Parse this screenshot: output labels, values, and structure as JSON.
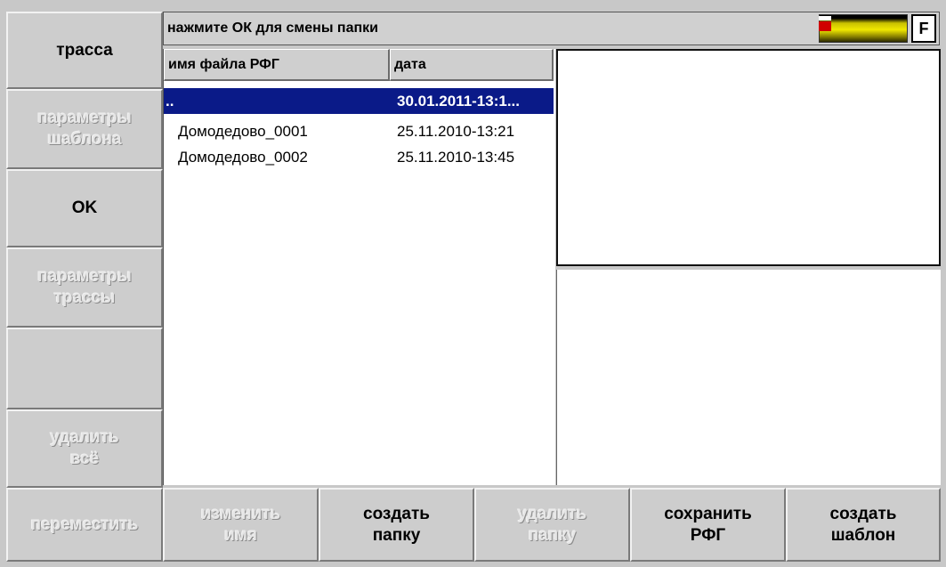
{
  "left_menu": [
    {
      "label": "трасса",
      "enabled": true
    },
    {
      "label": "параметры\nшаблона",
      "enabled": false
    },
    {
      "label": "OK",
      "enabled": true
    },
    {
      "label": "параметры\nтрассы",
      "enabled": false
    },
    {
      "label": "",
      "enabled": false
    },
    {
      "label": "удалить\nвсё",
      "enabled": false
    }
  ],
  "bottom_menu": [
    {
      "label": "переместить",
      "enabled": false
    },
    {
      "label": "изменить\nимя",
      "enabled": false
    },
    {
      "label": "создать\nпапку",
      "enabled": true
    },
    {
      "label": "удалить\nпапку",
      "enabled": false
    },
    {
      "label": "сохранить\nРФГ",
      "enabled": true
    },
    {
      "label": "создать\nшаблон",
      "enabled": true
    }
  ],
  "status": {
    "text": "нажмите ОК для смены папки",
    "f_label": "F"
  },
  "file_list": {
    "columns": [
      "имя файла РФГ",
      "дата"
    ],
    "rows": [
      {
        "name": "..",
        "date": "30.01.2011-13:1...",
        "selected": true
      },
      {
        "name": "Домодедово_0001",
        "date": "25.11.2010-13:21",
        "selected": false
      },
      {
        "name": "Домодедово_0002",
        "date": "25.11.2010-13:45",
        "selected": false
      }
    ]
  },
  "colors": {
    "selection": "#0a1a88",
    "indicator_red": "#d00000",
    "indicator_yellow": "#f0e800"
  }
}
